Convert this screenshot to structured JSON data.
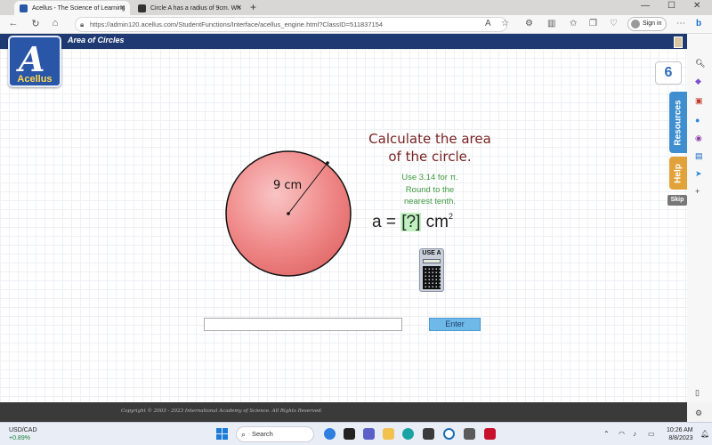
{
  "browser": {
    "tabs": [
      {
        "title": "Acellus - The Science of Learning",
        "active": true
      },
      {
        "title": "Circle A has a radius of 9cm. Wh",
        "active": false
      }
    ],
    "url_prefix": "https://",
    "url": "admin120.acellus.com/StudentFunctions/Interface/acellus_engine.html?ClassID=511837154",
    "sign_in": "Sign in"
  },
  "app": {
    "title": "Area of Circles",
    "logo_text": "Acellus",
    "logo_letter": "A",
    "counter": "6",
    "resources_label": "Resources",
    "help_label": "Help",
    "skip_label": "Skip"
  },
  "problem": {
    "radius_label": "9 cm",
    "question_line1": "Calculate the area",
    "question_line2": "of the circle.",
    "hint_line1": "Use 3.14 for π.",
    "hint_line2": "Round to the",
    "hint_line3": "nearest tenth.",
    "formula_prefix": "a = ",
    "formula_answer": "[?]",
    "formula_unit": "cm",
    "formula_exponent": "2",
    "calculator_label": "USE A",
    "answer_value": "",
    "enter_label": "Enter"
  },
  "footer": {
    "copyright": "Copyright © 2003 - 2023 International Academy of Science.  All Rights Reserved."
  },
  "taskbar": {
    "stock_symbol": "USD/CAD",
    "stock_change": "+0.89%",
    "search_placeholder": "Search",
    "time": "10:26 AM",
    "date": "8/8/2023"
  },
  "colors": {
    "header": "#1f3a72",
    "question": "#7a2323",
    "hint": "#3e9940",
    "circle_fill": "#f08a8a",
    "enter": "#6fb9e8"
  }
}
